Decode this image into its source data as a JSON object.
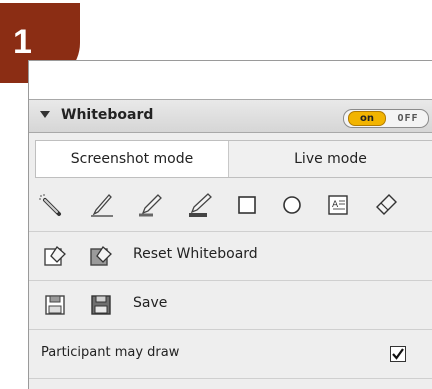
{
  "badge": {
    "number": "1"
  },
  "panel": {
    "title": "Whiteboard",
    "toggle": {
      "on_label": "on",
      "off_label": "OFF",
      "state": "on"
    }
  },
  "modes": [
    {
      "label": "Screenshot mode",
      "selected": true
    },
    {
      "label": "Live mode",
      "selected": false
    }
  ],
  "tools": [
    {
      "name": "pointer-tool-icon"
    },
    {
      "name": "pen-tool-icon"
    },
    {
      "name": "highlighter-tool-icon"
    },
    {
      "name": "marker-tool-icon"
    },
    {
      "name": "rectangle-tool-icon"
    },
    {
      "name": "ellipse-tool-icon"
    },
    {
      "name": "text-tool-icon"
    },
    {
      "name": "eraser-tool-icon"
    }
  ],
  "reset": {
    "label": "Reset Whiteboard"
  },
  "save": {
    "label": "Save"
  },
  "participant": {
    "label": "Participant may draw",
    "checked": true
  },
  "colors": {
    "badge": "#8b2d14",
    "toggle_on": "#f2b400",
    "panel_bg": "#eeeeee"
  }
}
